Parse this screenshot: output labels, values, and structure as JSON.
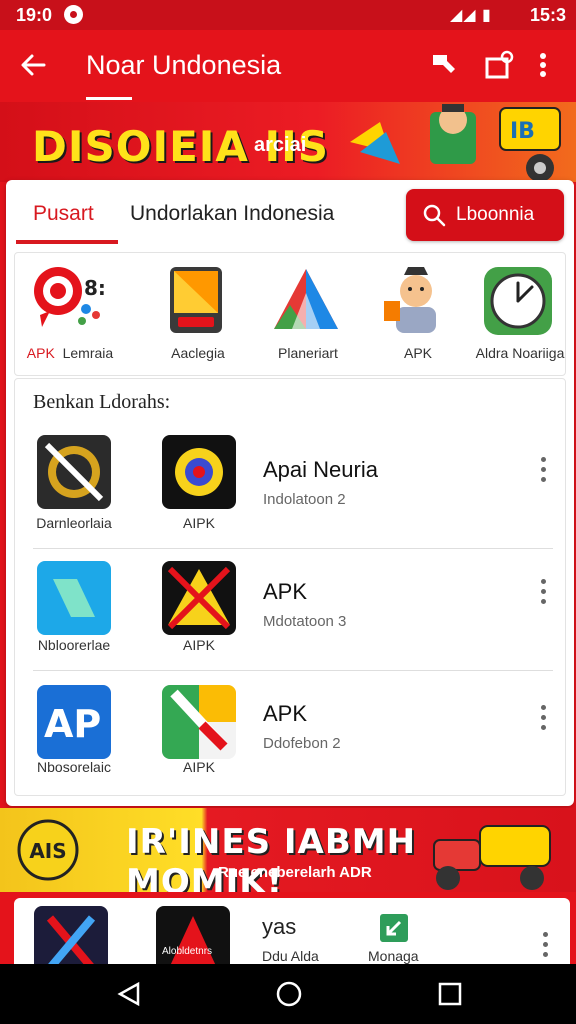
{
  "status_bar": {
    "time": "19:0",
    "right_time": "15:3",
    "signal": "◢◢ ▮"
  },
  "app_bar": {
    "title": "Noar Undonesia",
    "icons": [
      "back-arrow-icon",
      "bookmark-icon",
      "share-icon",
      "more-vert-icon"
    ]
  },
  "top_banner": {
    "headline": "DISOIEIA IIS",
    "sub": "arciai"
  },
  "tabs": {
    "active": "Pusart",
    "second": "Undorlakan  Indonesia"
  },
  "search_button": {
    "label": "Lboonnia",
    "icon": "search-icon"
  },
  "featured": [
    {
      "label": "APK",
      "label2": "Lemraia",
      "icon": "target-app-icon"
    },
    {
      "label": "Aaclegia",
      "icon": "fire-box-icon"
    },
    {
      "label": "Planeriart",
      "icon": "colorful-triangle-icon"
    },
    {
      "label": "APK",
      "icon": "character-icon"
    },
    {
      "label": "Aldra Noariiga",
      "icon": "clock-icon"
    }
  ],
  "section": {
    "title": "Benkan Ldorahs:",
    "rows": [
      {
        "cap1": "Darnleorlaia",
        "cap2": "AIPK",
        "name": "Apai Neuria",
        "sub": "Indolatoon 2"
      },
      {
        "cap1": "Nbloorerlae",
        "cap2": "AIPK",
        "name": "APK",
        "sub": "Mdotatoon 3"
      },
      {
        "cap1": "Nbosorelaic",
        "cap2": "AIPK",
        "name": "APK",
        "sub": "Ddofebon 2"
      }
    ]
  },
  "bottom_banner": {
    "headline": "IR'INES IABMH MOMIK!",
    "sub": "Rue eneberelarh ADR",
    "logo_text": "AIS"
  },
  "partial_row": {
    "cap1": "Alobldetnrs",
    "cap2": "Ddu Alda",
    "cap3": "Monaga",
    "logo_text": "yas"
  },
  "colors": {
    "primary": "#e4131b",
    "dark": "#c8101a",
    "accent_yellow": "#ffe21a"
  }
}
